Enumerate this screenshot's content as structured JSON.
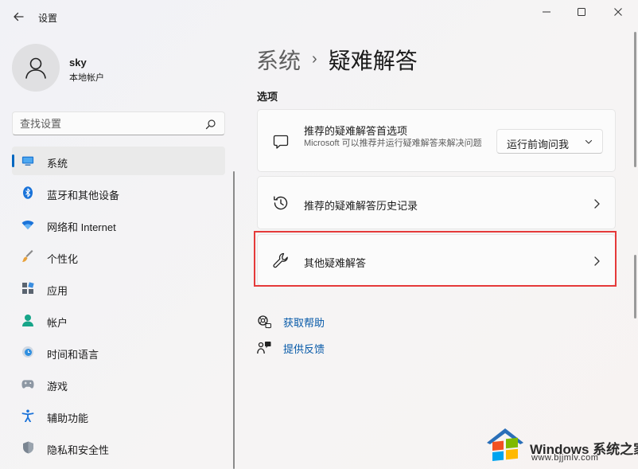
{
  "window": {
    "title": "设置",
    "controls": {
      "minimize": "minimize-icon",
      "maximize": "maximize-icon",
      "close": "close-icon"
    }
  },
  "profile": {
    "name": "sky",
    "account_type": "本地帐户"
  },
  "search": {
    "placeholder": "查找设置"
  },
  "sidebar": {
    "items": [
      {
        "label": "系统",
        "icon": "display-icon",
        "active": true
      },
      {
        "label": "蓝牙和其他设备",
        "icon": "bluetooth-icon"
      },
      {
        "label": "网络和 Internet",
        "icon": "wifi-icon"
      },
      {
        "label": "个性化",
        "icon": "brush-icon"
      },
      {
        "label": "应用",
        "icon": "apps-icon"
      },
      {
        "label": "帐户",
        "icon": "person-icon"
      },
      {
        "label": "时间和语言",
        "icon": "clock-globe-icon"
      },
      {
        "label": "游戏",
        "icon": "gamepad-icon"
      },
      {
        "label": "辅助功能",
        "icon": "accessibility-icon"
      },
      {
        "label": "隐私和安全性",
        "icon": "shield-icon"
      }
    ]
  },
  "breadcrumb": {
    "parent": "系统",
    "separator": "›",
    "current": "疑难解答"
  },
  "main": {
    "section_label": "选项",
    "cards": [
      {
        "title": "推荐的疑难解答首选项",
        "description": "Microsoft 可以推荐并运行疑难解答来解决问题",
        "icon": "chat-bubble-icon",
        "dropdown": {
          "selected": "运行前询问我"
        }
      },
      {
        "title": "推荐的疑难解答历史记录",
        "icon": "history-icon"
      },
      {
        "title": "其他疑难解答",
        "icon": "wrench-icon",
        "highlighted": true
      }
    ],
    "links": [
      {
        "label": "获取帮助",
        "icon": "help-icon"
      },
      {
        "label": "提供反馈",
        "icon": "feedback-icon"
      }
    ]
  },
  "watermark": {
    "brand": "Windows 系统之家",
    "site": "www.bjjmlv.com"
  },
  "colors": {
    "accent": "#0067c0",
    "link": "#0659a8",
    "highlight": "#e53a3a"
  }
}
